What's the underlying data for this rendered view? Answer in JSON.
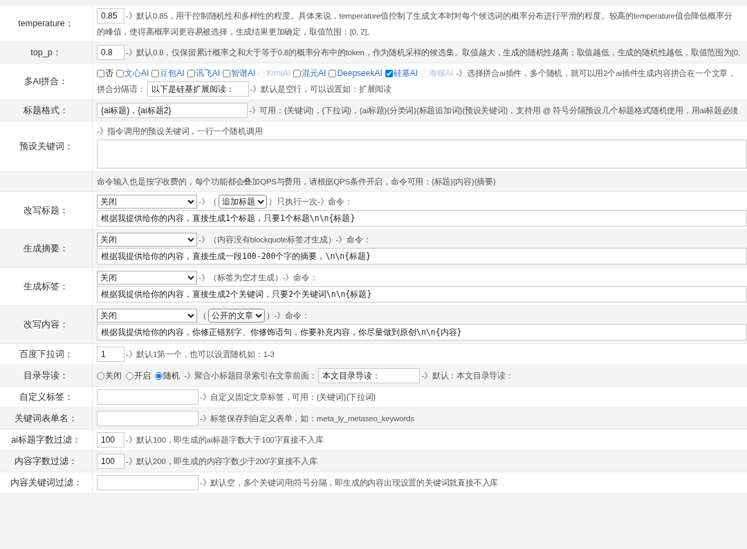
{
  "rows": [
    {
      "label": "temperature：",
      "lines": [
        [
          {
            "kind": "short-input",
            "value": "0.85"
          },
          {
            "kind": "hint",
            "text": "-》默认0.85，用于控制随机性和多样性的程度。具体来说，temperature值控制了生成文本时对每个候选词的概率分布进行平滑的程度。较高的temperature值会降低概率分"
          }
        ],
        [
          {
            "kind": "hint",
            "text": "的峰值，使得高概率词更容易被选择，生成结果更加确定，取值范围：[0, 2]。"
          }
        ]
      ]
    },
    {
      "label": "top_p：",
      "lines": [
        [
          {
            "kind": "short-input",
            "value": "0.8"
          },
          {
            "kind": "hint",
            "text": "-》默认0.8，仅保留累计概率之和大于等于0.8的概率分布中的token，作为随机采样的候选集。取值越大，生成的随机性越高；取值越低，生成的随机性越低，取值范围为[0,"
          }
        ]
      ]
    },
    {
      "label": "多AI拼合：",
      "lines": [
        [
          {
            "kind": "checkbox",
            "label": "否",
            "checked": false,
            "disabled": false
          },
          {
            "kind": "ai-checkbox",
            "label": "文心AI",
            "checked": false,
            "disabled": false
          },
          {
            "kind": "ai-checkbox",
            "label": "豆包AI",
            "checked": false,
            "disabled": false
          },
          {
            "kind": "ai-checkbox",
            "label": "讯飞AI",
            "checked": false,
            "disabled": false
          },
          {
            "kind": "ai-checkbox",
            "label": "智谱AI",
            "checked": false,
            "disabled": false
          },
          {
            "kind": "ai-checkbox",
            "label": "KimiAI",
            "checked": false,
            "disabled": true
          },
          {
            "kind": "ai-checkbox",
            "label": "混元AI",
            "checked": false,
            "disabled": false
          },
          {
            "kind": "ai-checkbox",
            "label": "DeepseekAI",
            "checked": false,
            "disabled": false
          },
          {
            "kind": "ai-checkbox",
            "label": "硅基AI",
            "checked": true,
            "disabled": false
          },
          {
            "kind": "ai-checkbox",
            "label": "海螺AI",
            "checked": false,
            "disabled": true
          },
          {
            "kind": "hint",
            "text": "-》选择拼合ai插件，多个随机，就可以用2个ai插件生成内容拼合在一个文章，"
          }
        ],
        [
          {
            "kind": "hint",
            "text": "拼合分隔语："
          },
          {
            "kind": "input",
            "value": "以下是硅基扩展阅读："
          },
          {
            "kind": "hint",
            "text": "-》默认是空行，可以设置如：扩展阅读"
          }
        ]
      ]
    },
    {
      "label": "标题格式：",
      "lines": [
        [
          {
            "kind": "long-input",
            "value": "{ai标题}，{ai标题2}"
          },
          {
            "kind": "hint",
            "text": "-》可用：{关键词}，{下拉词}，{ai标题}{分类词}{标题追加词}{预设关键词}，支持用 @ 符号分隔预设几个标题格式随机使用，用ai标题必须"
          }
        ]
      ]
    },
    {
      "label": "预设关键词：",
      "lines": [
        [
          {
            "kind": "hint",
            "text": "-》指令调用的预设关键词，一行一个随机调用"
          }
        ],
        [
          {
            "kind": "textarea"
          }
        ]
      ]
    },
    {
      "label": "",
      "lines": [
        [
          {
            "kind": "hint",
            "text": "命令输入也是按字收费的，每个功能都会叠加QPS与费用，请根据QPS条件开启，命令可用：{标题}{内容}{摘要}"
          }
        ]
      ]
    },
    {
      "label": "改写标题：",
      "lines": [
        [
          {
            "kind": "select",
            "value": "关闭"
          },
          {
            "kind": "hint",
            "text": "-》（"
          },
          {
            "kind": "inline-select",
            "value": "追加标题"
          },
          {
            "kind": "hint",
            "text": "）只执行一次-》命令："
          }
        ],
        [
          {
            "kind": "command",
            "value": "根据我提供给你的内容，直接生成1个标题，只要1个标题\\n\\n{标题}"
          }
        ]
      ]
    },
    {
      "label": "生成摘要：",
      "lines": [
        [
          {
            "kind": "select",
            "value": "关闭"
          },
          {
            "kind": "hint",
            "text": "-》（内容没有blockquote标签才生成）-》命令："
          }
        ],
        [
          {
            "kind": "command",
            "value": "根据我提供给你的内容，直接生成一段100-200个字的摘要，\\n\\n{标题}"
          }
        ]
      ]
    },
    {
      "label": "生成标签：",
      "lines": [
        [
          {
            "kind": "select",
            "value": "关闭"
          },
          {
            "kind": "hint",
            "text": "-》（标签为空才生成）-》命令："
          }
        ],
        [
          {
            "kind": "command",
            "value": "根据我提供给你的内容，直接生成2个关键词，只要2个关键词\\n\\n{标题}"
          }
        ]
      ]
    },
    {
      "label": "改写内容：",
      "lines": [
        [
          {
            "kind": "select",
            "value": "关闭"
          },
          {
            "kind": "hint",
            "text": "（"
          },
          {
            "kind": "inline-select",
            "value": "公开的文章"
          },
          {
            "kind": "hint",
            "text": "）-》命令："
          }
        ],
        [
          {
            "kind": "command",
            "value": "根据我提供给你的内容，你修正错别字、你修饰语句，你要补充内容，你尽量做到原创\\n\\n{内容}"
          }
        ]
      ]
    },
    {
      "label": "百度下拉词：",
      "lines": [
        [
          {
            "kind": "short-input",
            "value": "1"
          },
          {
            "kind": "hint",
            "text": "-》默认1第一个，也可以设置随机如：1-3"
          }
        ]
      ]
    },
    {
      "label": "目录导读：",
      "lines": [
        [
          {
            "kind": "radio",
            "label": "关闭",
            "selected": false
          },
          {
            "kind": "radio",
            "label": "开启",
            "selected": false
          },
          {
            "kind": "radio",
            "label": "随机",
            "selected": true
          },
          {
            "kind": "hint",
            "text": "-》聚合小标题目录索引在文章前面："
          },
          {
            "kind": "input",
            "value": "本文目录导读："
          },
          {
            "kind": "hint",
            "text": "-》默认：本文目录导读："
          }
        ]
      ]
    },
    {
      "label": "自定义标签：",
      "lines": [
        [
          {
            "kind": "input"
          },
          {
            "kind": "hint",
            "text": "-》自定义固定文章标签，可用：{关键词}{下拉词}"
          }
        ]
      ]
    },
    {
      "label": "关键词表单名：",
      "lines": [
        [
          {
            "kind": "input"
          },
          {
            "kind": "hint",
            "text": "-》标签保存到自定义表单，如：meta_ly_metaseo_keywords"
          }
        ]
      ]
    },
    {
      "label": "ai标题字数过滤：",
      "lines": [
        [
          {
            "kind": "short-input",
            "value": "100"
          },
          {
            "kind": "hint",
            "text": "-》默认100，即生成的ai标题字数大于100字直接不入库"
          }
        ]
      ]
    },
    {
      "label": "内容字数过滤：",
      "lines": [
        [
          {
            "kind": "short-input",
            "value": "100"
          },
          {
            "kind": "hint",
            "text": "-》默认200，即生成的内容字数少于200字直接不入库"
          }
        ]
      ]
    },
    {
      "label": "内容关键词过滤：",
      "lines": [
        [
          {
            "kind": "input"
          },
          {
            "kind": "hint",
            "text": "-》默认空，多个关键词用|符号分隔，即生成的内容出现设置的关键词就直接不入库"
          }
        ]
      ]
    }
  ]
}
